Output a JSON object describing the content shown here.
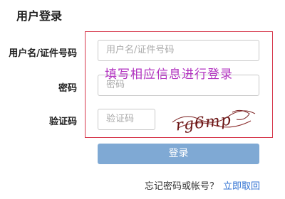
{
  "login": {
    "title": "用户登录",
    "username_label": "用户名/证件号码",
    "username_placeholder": "用户名/证件号码",
    "password_label": "密码",
    "password_placeholder": "密码",
    "captcha_label": "验证码",
    "captcha_placeholder": "验证码",
    "captcha_text": "rg6mp",
    "overlay_note": "填写相应信息进行登录",
    "login_button": "登录",
    "forgot_text": "忘记密码或帐号？",
    "retrieve_link": "立即取回"
  },
  "colors": {
    "button": "#7fa9d4",
    "highlight_border": "#d6364a",
    "overlay_text": "#b232c0",
    "link": "#2e6fd1"
  }
}
